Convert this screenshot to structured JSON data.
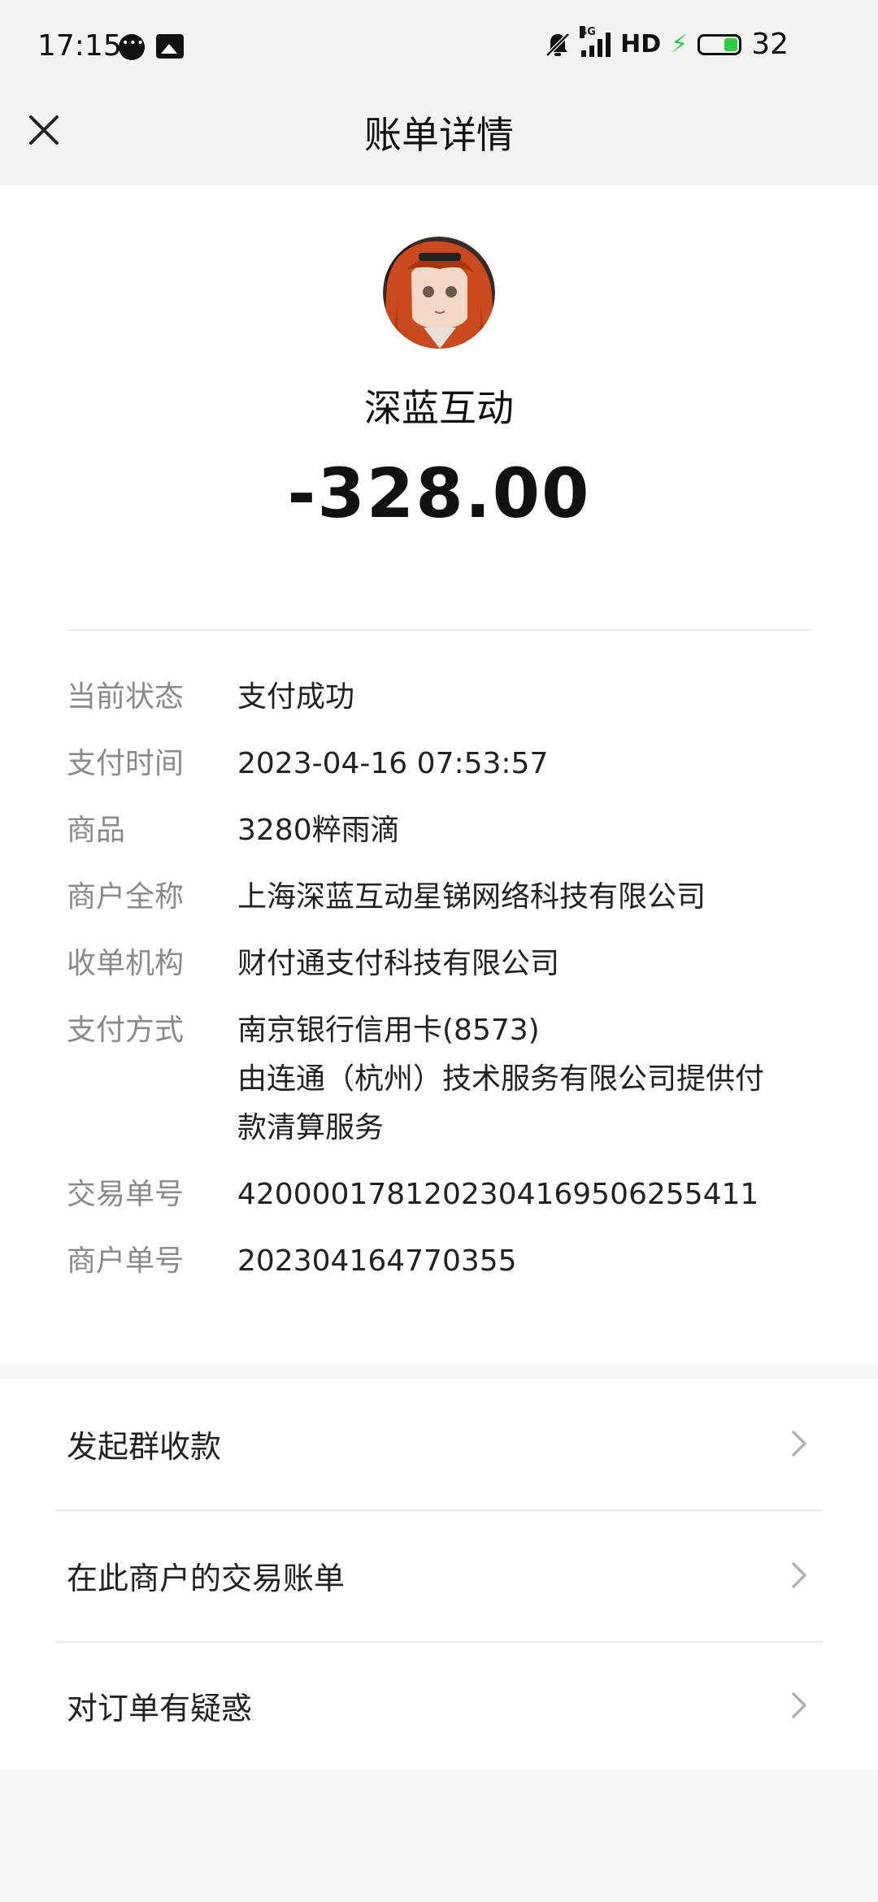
{
  "status_bar": {
    "time": "17:15",
    "network": "4G",
    "hd": "HD",
    "battery_level": "32"
  },
  "nav": {
    "title": "账单详情"
  },
  "merchant": {
    "name": "深蓝互动",
    "amount": "-328.00"
  },
  "details": {
    "status_label": "当前状态",
    "status_value": "支付成功",
    "time_label": "支付时间",
    "time_value": "2023-04-16 07:53:57",
    "product_label": "商品",
    "product_value": "3280粹雨滴",
    "merchant_full_label": "商户全称",
    "merchant_full_value": "上海深蓝互动星锑网络科技有限公司",
    "acquirer_label": "收单机构",
    "acquirer_value": "财付通支付科技有限公司",
    "method_label": "支付方式",
    "method_value_line1": "南京银行信用卡(8573)",
    "method_value_line2": "由连通（杭州）技术服务有限公司提供付",
    "method_value_line3": "款清算服务",
    "txn_label": "交易单号",
    "txn_value": "4200001781202304169506255411",
    "order_label": "商户单号",
    "order_value": "202304164770355"
  },
  "actions": {
    "group_collect": "发起群收款",
    "merchant_bills": "在此商户的交易账单",
    "order_question": "对订单有疑惑"
  },
  "icons": {
    "close": "close-icon",
    "chevron": "chevron-right-icon"
  },
  "colors": {
    "label_gray": "#8a8a8a",
    "header_bg": "#f2f2f2",
    "battery_green": "#2ecc40"
  }
}
